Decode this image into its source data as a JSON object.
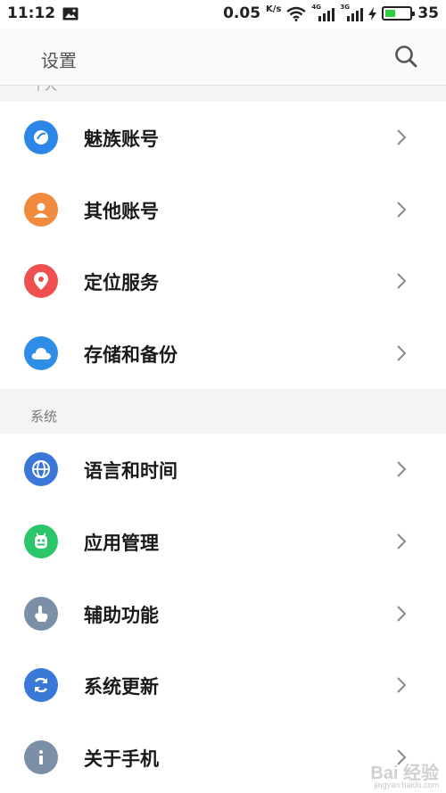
{
  "status_bar": {
    "time": "11:12",
    "speed": "0.05",
    "speed_unit": "K/s",
    "sim1_tag": "4G",
    "sim2_tag": "3G",
    "battery": "35"
  },
  "header": {
    "title": "设置"
  },
  "section_personal": {
    "label": "个人"
  },
  "rows_personal": [
    {
      "label": "魅族账号",
      "icon": "flyme-account-icon",
      "color": "#2b86e8"
    },
    {
      "label": "其他账号",
      "icon": "person-icon",
      "color": "#f08a3c"
    },
    {
      "label": "定位服务",
      "icon": "location-pin-icon",
      "color": "#ef4f4f"
    },
    {
      "label": "存储和备份",
      "icon": "cloud-icon",
      "color": "#2e8de6"
    }
  ],
  "section_system": {
    "label": "系统"
  },
  "rows_system": [
    {
      "label": "语言和时间",
      "icon": "globe-icon",
      "color": "#3a78d8"
    },
    {
      "label": "应用管理",
      "icon": "android-icon",
      "color": "#2bc56a"
    },
    {
      "label": "辅助功能",
      "icon": "hand-pointer-icon",
      "color": "#7b8fa6"
    },
    {
      "label": "系统更新",
      "icon": "refresh-icon",
      "color": "#3a78d8"
    },
    {
      "label": "关于手机",
      "icon": "info-icon",
      "color": "#7b8fa6"
    }
  ],
  "watermark": {
    "text": "Bai 经验",
    "sub": "jingyan.baidu.com"
  }
}
